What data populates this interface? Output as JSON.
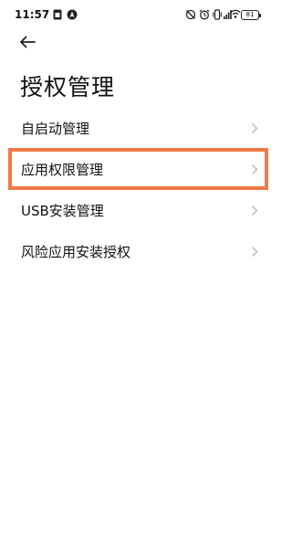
{
  "status_bar": {
    "time": "11:57",
    "battery": "81",
    "left_icons": [
      "sim-card-icon",
      "navigation-icon"
    ],
    "right_icons": [
      "no-disturb-icon",
      "alarm-icon",
      "vibrate-icon",
      "signal-icon",
      "wifi-icon",
      "battery-icon"
    ]
  },
  "header": {
    "back_icon": "back-arrow-icon",
    "title": "授权管理"
  },
  "menu": {
    "items": [
      {
        "label": "自启动管理",
        "icon": "chevron-right-icon"
      },
      {
        "label": "应用权限管理",
        "icon": "chevron-right-icon",
        "highlighted": true
      },
      {
        "label": "USB安装管理",
        "icon": "chevron-right-icon"
      },
      {
        "label": "风险应用安装授权",
        "icon": "chevron-right-icon"
      }
    ]
  },
  "colors": {
    "highlight_border": "#f07a45",
    "chevron": "#b5b5b5",
    "text": "#111111",
    "background": "#ffffff"
  }
}
